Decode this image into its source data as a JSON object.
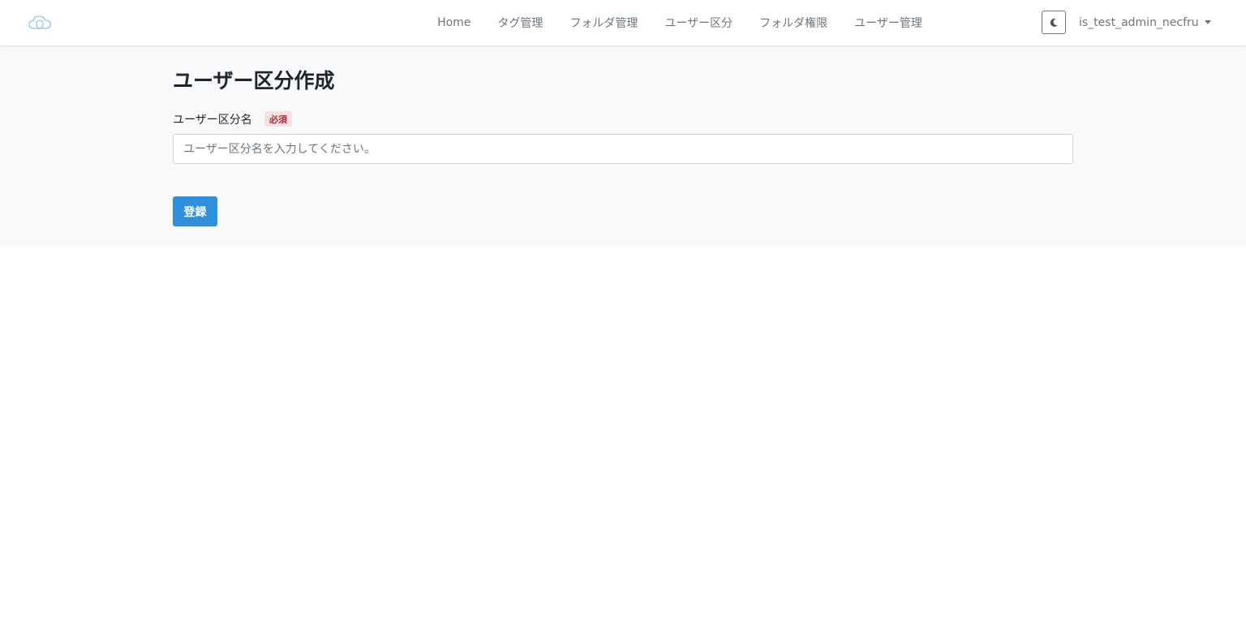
{
  "nav": {
    "brand_icon": "cloud-shield-icon",
    "links": [
      {
        "label": "Home"
      },
      {
        "label": "タグ管理"
      },
      {
        "label": "フォルダ管理"
      },
      {
        "label": "ユーザー区分"
      },
      {
        "label": "フォルダ権限"
      },
      {
        "label": "ユーザー管理"
      }
    ],
    "theme_icon": "moon-icon",
    "user_name": "is_test_admin_necfru"
  },
  "form": {
    "title": "ユーザー区分作成",
    "field_label": "ユーザー区分名",
    "required_badge": "必須",
    "input_value": "",
    "input_placeholder": "ユーザー区分名を入力してください。",
    "submit_label": "登録"
  },
  "colors": {
    "primary": "#2e8fdd",
    "brand_icon": "#8fc2ea",
    "required_text": "#b02a37",
    "required_bg": "#f8e1e3"
  }
}
